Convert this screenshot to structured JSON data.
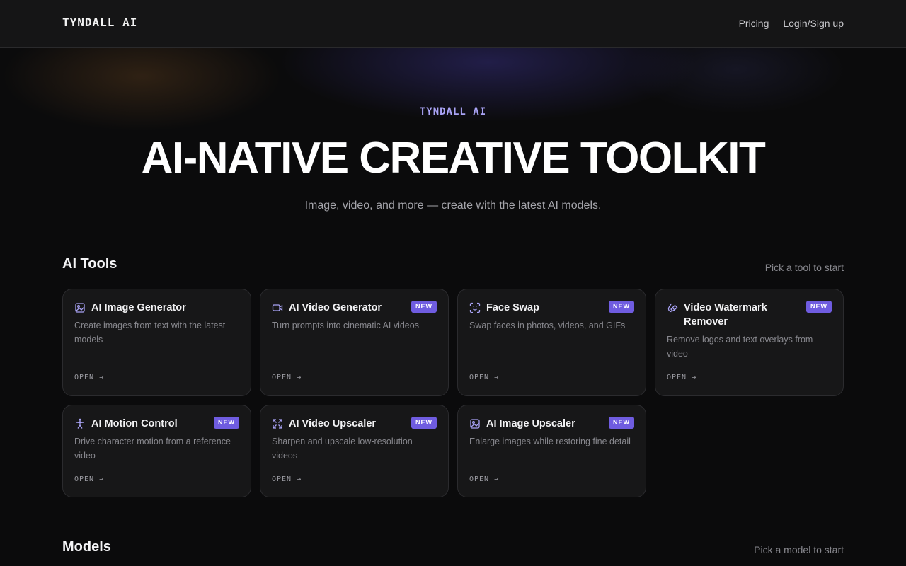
{
  "header": {
    "logo": "TYNDALL AI",
    "nav": [
      "Pricing",
      "Login/Sign up"
    ]
  },
  "hero": {
    "eyebrow": "TYNDALL AI",
    "title": "AI-NATIVE CREATIVE TOOLKIT",
    "subtitle": "Image, video, and more — create with the latest AI models."
  },
  "tools_section": {
    "title": "AI Tools",
    "hint": "Pick a tool to start",
    "open_label": "OPEN →",
    "badge_label": "NEW",
    "tools": [
      {
        "title": "AI Image Generator",
        "desc": "Create images from text with the latest models",
        "icon": "image-icon",
        "is_new": false
      },
      {
        "title": "AI Video Generator",
        "desc": "Turn prompts into cinematic AI videos",
        "icon": "video-camera-icon",
        "is_new": true
      },
      {
        "title": "Face Swap",
        "desc": "Swap faces in photos, videos, and GIFs",
        "icon": "face-scan-icon",
        "is_new": true
      },
      {
        "title": "Video Watermark Remover",
        "desc": "Remove logos and text overlays from video",
        "icon": "eraser-drop-icon",
        "is_new": true
      },
      {
        "title": "AI Motion Control",
        "desc": "Drive character motion from a reference video",
        "icon": "person-motion-icon",
        "is_new": true
      },
      {
        "title": "AI Video Upscaler",
        "desc": "Sharpen and upscale low-resolution videos",
        "icon": "expand-icon",
        "is_new": true
      },
      {
        "title": "AI Image Upscaler",
        "desc": "Enlarge images while restoring fine detail",
        "icon": "image-icon",
        "is_new": true
      }
    ]
  },
  "models_section": {
    "title": "Models",
    "hint": "Pick a model to start"
  },
  "colors": {
    "accent": "#6f5ce0",
    "eyebrow": "#a9a3f5",
    "background": "#0b0b0c",
    "card": "#171718"
  }
}
